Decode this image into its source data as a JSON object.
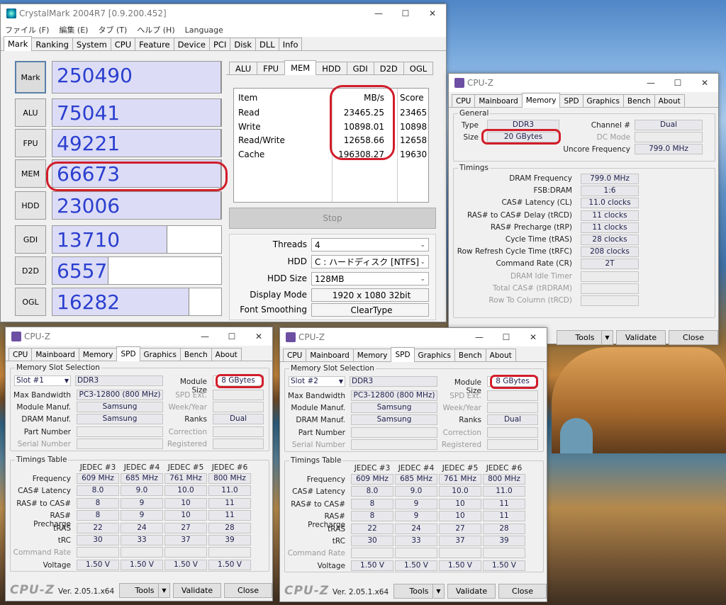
{
  "crystalmark": {
    "title": "CrystalMark 2004R7 [0.9.200.452]",
    "menu": [
      "ファイル (F)",
      "編集 (E)",
      "タブ (T)",
      "ヘルプ (H)",
      "Language"
    ],
    "tabs": [
      "Mark",
      "Ranking",
      "System",
      "CPU",
      "Feature",
      "Device",
      "PCI",
      "Disk",
      "DLL",
      "Info"
    ],
    "scores": [
      {
        "label": "Mark",
        "value": "250490",
        "fill": 1.0
      },
      {
        "label": "ALU",
        "value": "75041",
        "fill": 1.0
      },
      {
        "label": "FPU",
        "value": "49221",
        "fill": 1.0
      },
      {
        "label": "MEM",
        "value": "66673",
        "fill": 1.0
      },
      {
        "label": "HDD",
        "value": "23006",
        "fill": 1.0
      },
      {
        "label": "GDI",
        "value": "13710",
        "fill": 0.68
      },
      {
        "label": "D2D",
        "value": "6557",
        "fill": 0.33
      },
      {
        "label": "OGL",
        "value": "16282",
        "fill": 0.81
      }
    ],
    "subtabs": [
      "ALU",
      "FPU",
      "MEM",
      "HDD",
      "GDI",
      "D2D",
      "OGL"
    ],
    "table": {
      "headers": [
        "Item",
        "MB/s",
        "Score"
      ],
      "rows": [
        [
          "Read",
          "23465.25",
          "23465"
        ],
        [
          "Write",
          "10898.01",
          "10898"
        ],
        [
          "Read/Write",
          "12658.66",
          "12658"
        ],
        [
          "Cache",
          "196308.27",
          "19630"
        ]
      ]
    },
    "stop": "Stop",
    "settings": [
      {
        "label": "Threads",
        "value": "4"
      },
      {
        "label": "HDD",
        "value": "C : ハードディスク [NTFS]"
      },
      {
        "label": "HDD Size",
        "value": "128MB"
      },
      {
        "label": "Display Mode",
        "value": "1920 x 1080 32bit"
      },
      {
        "label": "Font Smoothing",
        "value": "ClearType"
      }
    ]
  },
  "cpuz_mem": {
    "title": "CPU-Z",
    "tabs": [
      "CPU",
      "Mainboard",
      "Memory",
      "SPD",
      "Graphics",
      "Bench",
      "About"
    ],
    "general": "General",
    "type_label": "Type",
    "type": "DDR3",
    "size_label": "Size",
    "size": "20 GBytes",
    "channel_label": "Channel #",
    "channel": "Dual",
    "dcmode_label": "DC Mode",
    "uncore_label": "Uncore Frequency",
    "uncore": "799.0 MHz",
    "timings": "Timings",
    "rows": [
      {
        "label": "DRAM Frequency",
        "value": "799.0 MHz"
      },
      {
        "label": "FSB:DRAM",
        "value": "1:6"
      },
      {
        "label": "CAS# Latency (CL)",
        "value": "11.0 clocks"
      },
      {
        "label": "RAS# to CAS# Delay (tRCD)",
        "value": "11 clocks"
      },
      {
        "label": "RAS# Precharge (tRP)",
        "value": "11 clocks"
      },
      {
        "label": "Cycle Time (tRAS)",
        "value": "28 clocks"
      },
      {
        "label": "Row Refresh Cycle Time (tRFC)",
        "value": "208 clocks"
      },
      {
        "label": "Command Rate (CR)",
        "value": "2T"
      },
      {
        "label": "DRAM Idle Timer",
        "value": ""
      },
      {
        "label": "Total CAS# (tRDRAM)",
        "value": ""
      },
      {
        "label": "Row To Column (tRCD)",
        "value": ""
      }
    ],
    "tools": "Tools",
    "validate": "Validate",
    "close": "Close"
  },
  "spd": [
    {
      "slot": "Slot #1",
      "type": "DDR3",
      "module_size": "8 GBytes",
      "max_bw": "PC3-12800 (800 MHz)",
      "manuf": "Samsung",
      "dram": "Samsung",
      "ranks": "Dual"
    },
    {
      "slot": "Slot #2",
      "type": "DDR3",
      "module_size": "8 GBytes",
      "max_bw": "PC3-12800 (800 MHz)",
      "manuf": "Samsung",
      "dram": "Samsung",
      "ranks": "Dual"
    }
  ],
  "spd_common": {
    "title": "CPU-Z",
    "tabs": [
      "CPU",
      "Mainboard",
      "Memory",
      "SPD",
      "Graphics",
      "Bench",
      "About"
    ],
    "group1": "Memory Slot Selection",
    "module_size_label": "Module Size",
    "max_bw_label": "Max Bandwidth",
    "spd_ext_label": "SPD Ext.",
    "manuf_label": "Module Manuf.",
    "week_label": "Week/Year",
    "dram_label": "DRAM Manuf.",
    "ranks_label": "Ranks",
    "part_label": "Part Number",
    "corr_label": "Correction",
    "serial_label": "Serial Number",
    "reg_label": "Registered",
    "group2": "Timings Table",
    "jedec": [
      "JEDEC #3",
      "JEDEC #4",
      "JEDEC #5",
      "JEDEC #6"
    ],
    "trows": [
      {
        "label": "Frequency",
        "vals": [
          "609 MHz",
          "685 MHz",
          "761 MHz",
          "800 MHz"
        ]
      },
      {
        "label": "CAS# Latency",
        "vals": [
          "8.0",
          "9.0",
          "10.0",
          "11.0"
        ]
      },
      {
        "label": "RAS# to CAS#",
        "vals": [
          "8",
          "9",
          "10",
          "11"
        ]
      },
      {
        "label": "RAS# Precharge",
        "vals": [
          "8",
          "9",
          "10",
          "11"
        ]
      },
      {
        "label": "tRAS",
        "vals": [
          "22",
          "24",
          "27",
          "28"
        ]
      },
      {
        "label": "tRC",
        "vals": [
          "30",
          "33",
          "37",
          "39"
        ]
      },
      {
        "label": "Command Rate",
        "vals": [
          "",
          "",
          "",
          ""
        ]
      },
      {
        "label": "Voltage",
        "vals": [
          "1.50 V",
          "1.50 V",
          "1.50 V",
          "1.50 V"
        ]
      }
    ],
    "logo": "CPU-Z",
    "version": "Ver. 2.05.1.x64",
    "tools": "Tools",
    "validate": "Validate",
    "close": "Close"
  }
}
